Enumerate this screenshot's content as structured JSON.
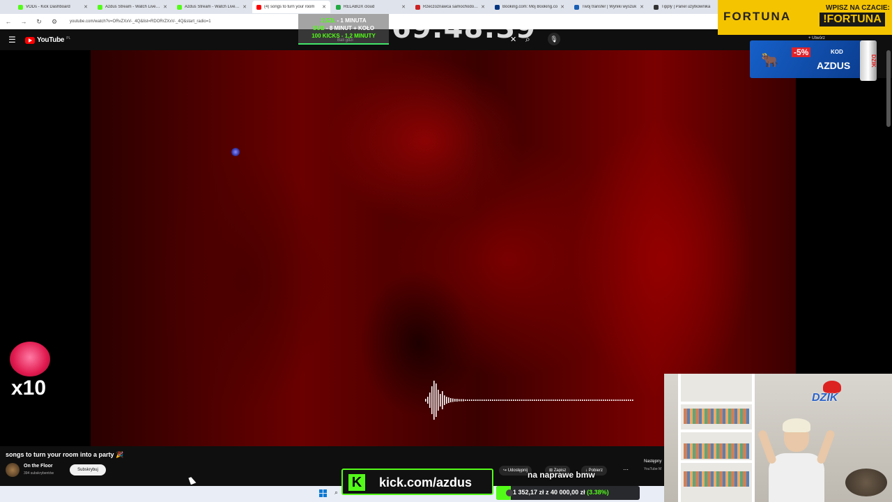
{
  "browser": {
    "tabs": [
      {
        "label": "VODs - Kick Dashboard",
        "color": "#53fc18",
        "active": false
      },
      {
        "label": "Azdus Stream - Watch Live on",
        "color": "#53fc18",
        "active": false
      },
      {
        "label": "Azdus Stream - Watch Live on",
        "color": "#53fc18",
        "active": false
      },
      {
        "label": "(4) songs to turn your room",
        "color": "#ff0000",
        "active": true
      },
      {
        "label": "RELABOX cloud",
        "color": "#22aa44",
        "active": false
      },
      {
        "label": "Rzeczoznawca samochodowy",
        "color": "#cc2222",
        "active": false
      },
      {
        "label": "Booking.com: Mój Booking.co",
        "color": "#003580",
        "active": false
      },
      {
        "label": "Twój transfer | Wyniki wyszuk",
        "color": "#1a5fb4",
        "active": false
      },
      {
        "label": "Tipply | Panel użytkownika",
        "color": "#333333",
        "active": false
      }
    ],
    "url": "youtube.com/watch?v=ORvZXxV-_4Q&list=RDORrZXxV-_4Q&start_radio=1"
  },
  "youtube": {
    "brand": "YouTube",
    "country": "PL",
    "create_label": "+ Utwórz",
    "video_title": "songs to turn your room into a party 🎉",
    "channel_name": "On the Floor",
    "channel_subs": "394 subskrybentów",
    "subscribe_label": "Subskrybuj",
    "actions": {
      "share": "Udostępnij",
      "save": "Zapisz",
      "download": "Pobierz"
    },
    "next_up": "Następny",
    "next_sub": "YouTube M",
    "search_close_icon": "close-icon",
    "search_icon": "search-icon",
    "mic_icon": "mic-icon"
  },
  "overlays": {
    "subathon": {
      "line1_prefix": "2,5ZŁ",
      "line1_rest": " - 1 MINUTA",
      "line2_prefix": "SUB",
      "line2_rest": " - 8 MINUT + KOŁO",
      "line3": "100 KICKS - 1,2 MINUTY",
      "hidden_text": "Bali gdzi"
    },
    "timer": "69:48:39",
    "fortuna": {
      "logo": "FORTUNA",
      "prompt": "WPISZ NA CZACIE:",
      "command": "!FORTUNA"
    },
    "dzik_ad": {
      "discount": "-5%",
      "kod_label": "KOD",
      "code": "AZDUS",
      "can_brand": "DZIK"
    },
    "multiplier": "x10",
    "webcam_logo": "DZIK",
    "kick_url": "kick.com/azdus",
    "kick_letter": "K",
    "caption": "na naprawe bmw",
    "goal": {
      "text": "1 352,17 zł  z  40 000,00 zł",
      "percent_text": "(3.38%)",
      "progress": 0.0338
    }
  }
}
